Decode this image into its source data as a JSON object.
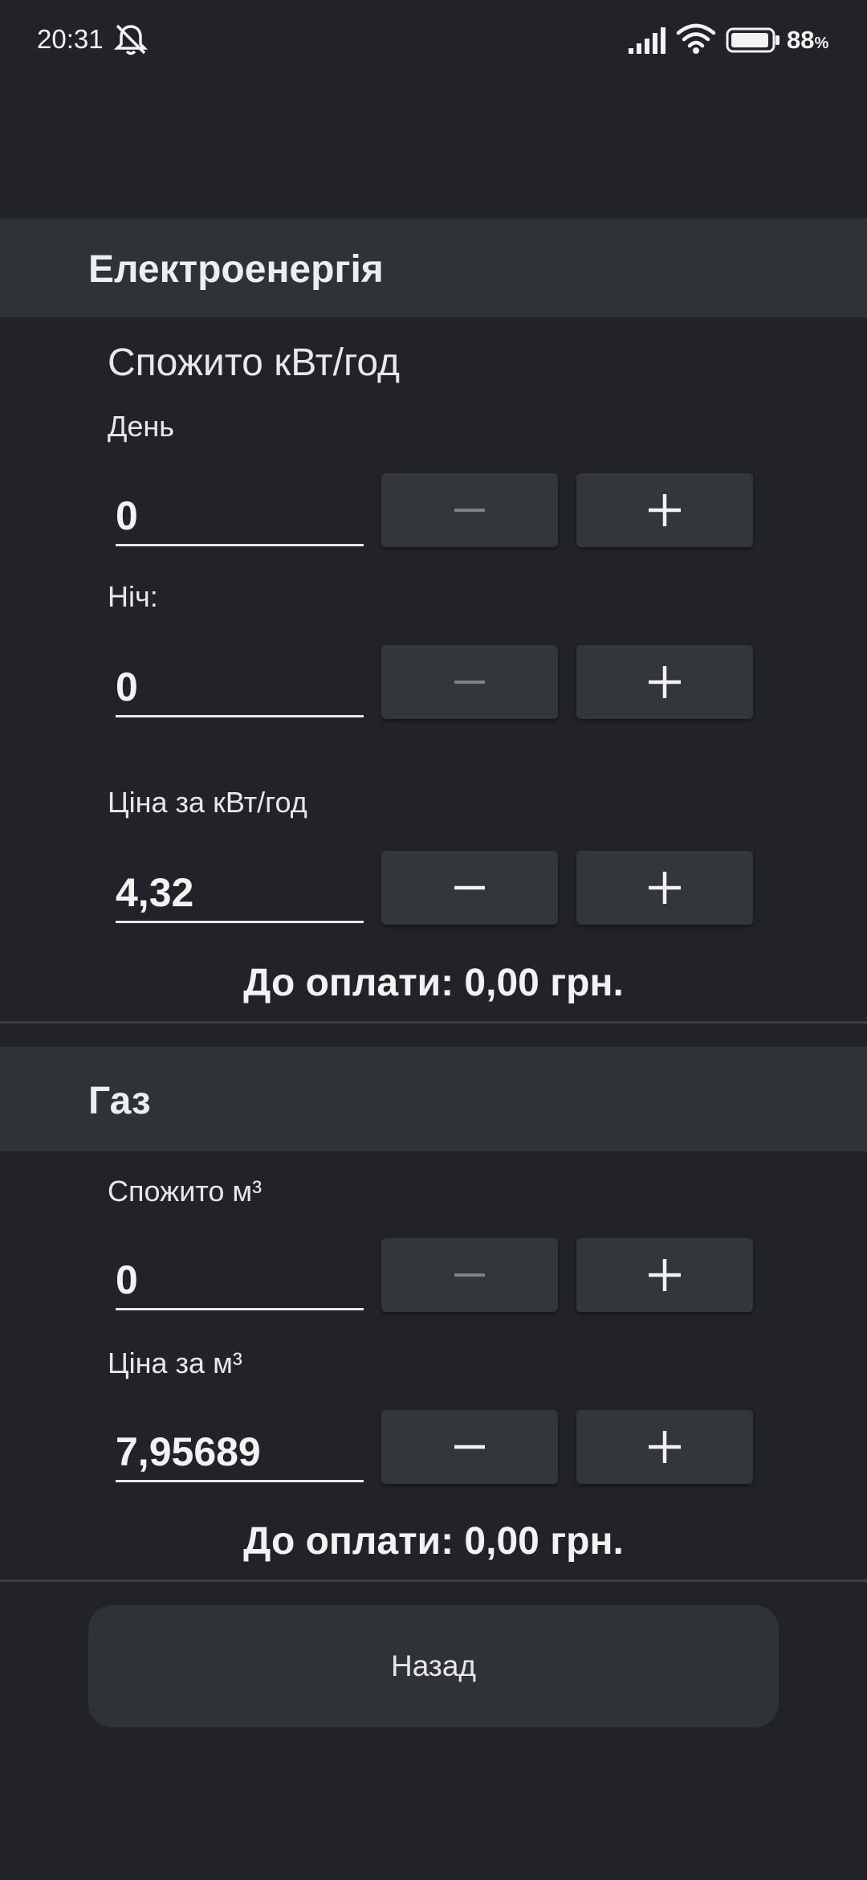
{
  "status_bar": {
    "time": "20:31",
    "battery_percent": "88",
    "battery_unit": "%",
    "icons": [
      "mute-icon",
      "signal-icon",
      "wifi-icon",
      "battery-icon"
    ]
  },
  "electricity": {
    "title": "Електроенергія",
    "consumed_label": "Спожито кВт/год",
    "day_label": "День",
    "day_value": "0",
    "night_label": "Ніч:",
    "night_value": "0",
    "price_label": "Ціна за кВт/год",
    "price_value": "4,32",
    "total": "До оплати: 0,00 грн."
  },
  "gas": {
    "title": "Газ",
    "consumed_label": "Спожито м³",
    "consumed_value": "0",
    "price_label": "Ціна за м³",
    "price_value": "7,95689",
    "total": "До оплати: 0,00 грн."
  },
  "back_button_label": "Назад",
  "colors": {
    "background": "#212328",
    "section_header": "#2f3237",
    "button": "#33363b",
    "text": "#eceef1",
    "disabled_icon": "#7d8085"
  }
}
